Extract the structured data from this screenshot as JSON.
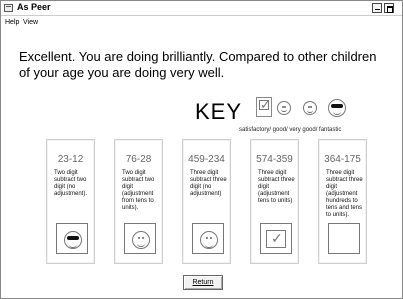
{
  "window": {
    "title": "As Peer"
  },
  "menu": {
    "help": "Help",
    "view": "View"
  },
  "message": "Excellent. You are doing brilliantly. Compared to other children of your age you are doing very well.",
  "key": {
    "label": "KEY",
    "caption": "satisfactory/ good/ very good/ fantastic",
    "symbols": [
      "check-icon",
      "smiley-face-icon",
      "happy-face-icon",
      "sunglasses-face-icon"
    ]
  },
  "cards": [
    {
      "numbers": "23-12",
      "description": "Two digit subtract two digit (no adjustment).",
      "rating": "fantastic"
    },
    {
      "numbers": "76-28",
      "description": "Two digit subtract two digit (adjustment from tens to units).",
      "rating": "good"
    },
    {
      "numbers": "459-234",
      "description": "Three digit subtract three digit (no adjustment)",
      "rating": "very good"
    },
    {
      "numbers": "574-359",
      "description": "Three digit subtract three digit (adjustment tens to units)",
      "rating": "satisfactory"
    },
    {
      "numbers": "364-175",
      "description": "Three digit subtract three digit (adjustment hundreds to tens and tens to units).",
      "rating": ""
    }
  ],
  "buttons": {
    "return": "Return"
  }
}
